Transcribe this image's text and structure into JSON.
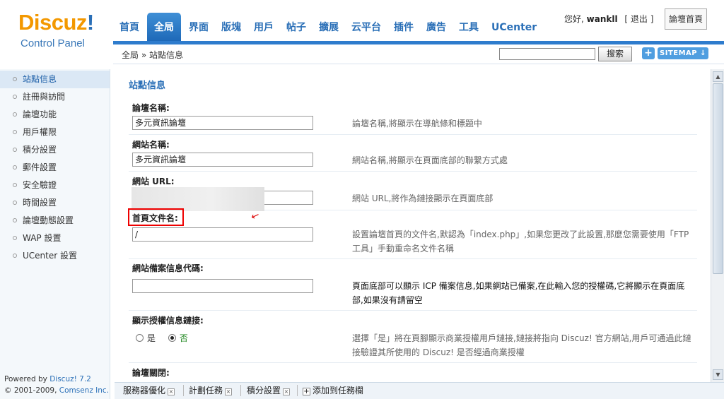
{
  "logo": {
    "brand_d": "Discuz",
    "brand_bang": "!",
    "subtitle": "Control Panel"
  },
  "topnav": {
    "tabs": [
      {
        "label": "首頁",
        "active": false
      },
      {
        "label": "全局",
        "active": true
      },
      {
        "label": "界面",
        "active": false
      },
      {
        "label": "版塊",
        "active": false
      },
      {
        "label": "用戶",
        "active": false
      },
      {
        "label": "帖子",
        "active": false
      },
      {
        "label": "擴展",
        "active": false
      },
      {
        "label": "云平台",
        "active": false
      },
      {
        "label": "插件",
        "active": false
      },
      {
        "label": "廣告",
        "active": false
      },
      {
        "label": "工具",
        "active": false
      },
      {
        "label": "UCenter",
        "active": false
      }
    ]
  },
  "user": {
    "greeting": "您好,",
    "username": "wankll",
    "logout": "[ 退出 ]",
    "home_button": "論壇首頁"
  },
  "crumb": {
    "text": "全局 » 站點信息",
    "search_button": "搜索",
    "plus": "+",
    "sitemap": "SITEMAP ↓"
  },
  "sidebar": {
    "items": [
      {
        "label": "站點信息",
        "active": true
      },
      {
        "label": "註冊與訪問",
        "active": false
      },
      {
        "label": "論壇功能",
        "active": false
      },
      {
        "label": "用戶權限",
        "active": false
      },
      {
        "label": "積分設置",
        "active": false
      },
      {
        "label": "郵件設置",
        "active": false
      },
      {
        "label": "安全驗證",
        "active": false
      },
      {
        "label": "時間設置",
        "active": false
      },
      {
        "label": "論壇動態設置",
        "active": false
      },
      {
        "label": "WAP 設置",
        "active": false
      },
      {
        "label": "UCenter 設置",
        "active": false
      }
    ],
    "footer": {
      "powered_prefix": "Powered by ",
      "powered_brand": "Discuz! 7.2",
      "copyright_prefix": "© 2001-2009, ",
      "copyright_brand": "Comsenz Inc."
    }
  },
  "main": {
    "section_title": "站點信息",
    "rows": {
      "forum_name": {
        "label": "論壇名稱:",
        "value": "多元資訊論壇",
        "hint": "論壇名稱,將顯示在導航條和標題中"
      },
      "site_name": {
        "label": "網站名稱:",
        "value": "多元資訊論壇",
        "hint": "網站名稱,將顯示在頁面底部的聯繫方式處"
      },
      "site_url": {
        "label": "網站 URL:",
        "value": "",
        "hint": "網站 URL,將作為鏈接顯示在頁面底部"
      },
      "index_file": {
        "label": "首頁文件名:",
        "value": "/",
        "hint": "設置論壇首頁的文件名,默認為「index.php」,如果您更改了此設置,那麼您需要使用「FTP工具」手動重命名文件名稱"
      },
      "icp": {
        "label": "網站備案信息代碼:",
        "value": "",
        "hint": "頁面底部可以顯示 ICP 備案信息,如果網站已備案,在此輸入您的授權碼,它將顯示在頁面底部,如果沒有請留空"
      },
      "license_link": {
        "label": "顯示授權信息鏈接:",
        "yes": "是",
        "no": "否",
        "selected": "no",
        "hint": "選擇「是」將在頁腳顯示商業授權用戶鏈接,鏈接將指向 Discuz! 官方網站,用戶可通過此鏈接驗證其所使用的 Discuz! 是否經過商業授權"
      },
      "forum_close": {
        "label": "論壇關閉:"
      }
    }
  },
  "taskbar": {
    "tasks": [
      "服務器優化",
      "計劃任務",
      "積分設置"
    ],
    "add": "添加到任務欄"
  },
  "colors": {
    "brand_blue": "#2a6fb7",
    "brand_orange": "#f39800",
    "nav_active": "#2e7ccd",
    "highlight_red": "#e00000"
  }
}
